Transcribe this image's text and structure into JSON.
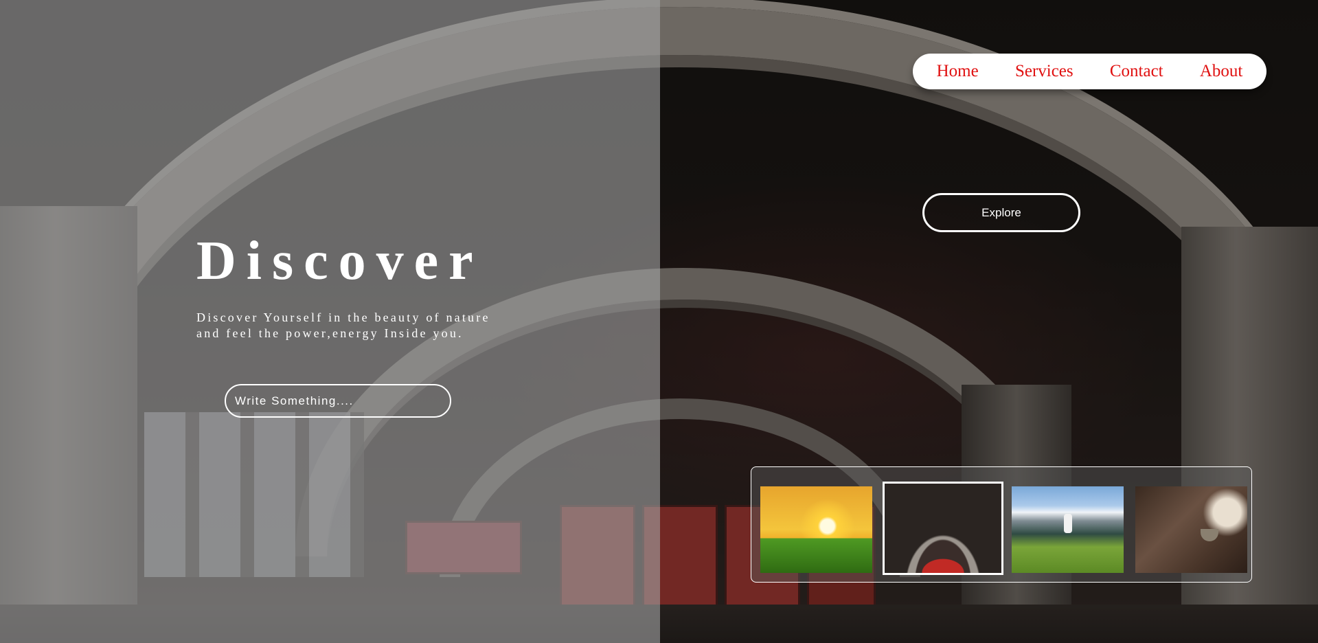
{
  "nav": {
    "items": [
      {
        "label": "Home"
      },
      {
        "label": "Services"
      },
      {
        "label": "Contact"
      },
      {
        "label": "About"
      }
    ]
  },
  "hero": {
    "title": "Discover",
    "subtitle_line1": "Discover Yourself in the beauty of nature",
    "subtitle_line2": "and feel the power,energy Inside you.",
    "input_placeholder": "Write Something....",
    "explore_label": "Explore"
  },
  "colors": {
    "nav_link": "#e01010",
    "nav_bg": "#ffffff",
    "text": "#ffffff"
  }
}
